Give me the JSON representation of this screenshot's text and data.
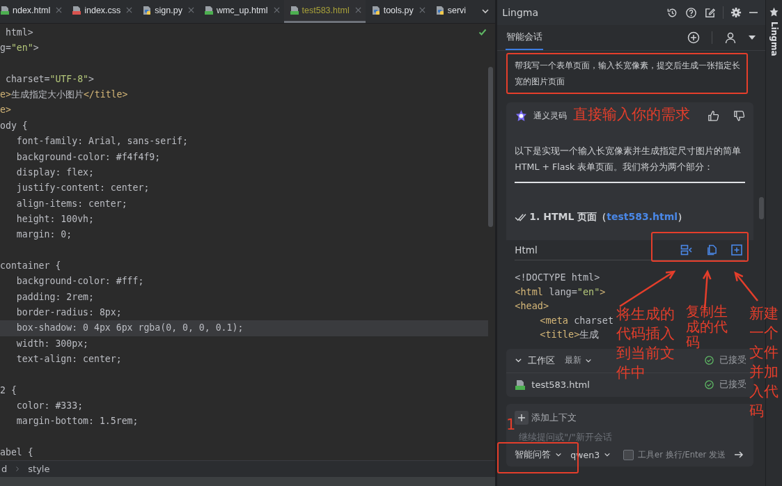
{
  "editor": {
    "tabs": [
      {
        "label": "ndex.html",
        "kind": "html",
        "selected": false,
        "closable": true
      },
      {
        "label": "index.css",
        "kind": "css",
        "selected": false,
        "closable": true
      },
      {
        "label": "sign.py",
        "kind": "py",
        "selected": false,
        "closable": true
      },
      {
        "label": "wmc_up.html",
        "kind": "html",
        "selected": false,
        "closable": true
      },
      {
        "label": "test583.html",
        "kind": "html",
        "selected": true,
        "closable": true
      },
      {
        "label": "tools.py",
        "kind": "py",
        "selected": false,
        "closable": true
      },
      {
        "label": "servi",
        "kind": "py",
        "selected": false,
        "closable": false
      }
    ],
    "lines": [
      {
        "kind": "code",
        "current": false,
        "segments": [
          {
            "text": " html>",
            "kind": "plain"
          }
        ]
      },
      {
        "kind": "code",
        "current": false,
        "segments": [
          {
            "text": "g=",
            "kind": "plain"
          },
          {
            "text": "\"en\"",
            "kind": "str"
          },
          {
            "text": ">",
            "kind": "plain"
          }
        ]
      },
      {
        "kind": "blank",
        "current": false
      },
      {
        "kind": "code",
        "current": false,
        "segments": [
          {
            "text": " charset=",
            "kind": "plain"
          },
          {
            "text": "\"UTF-8\"",
            "kind": "str"
          },
          {
            "text": ">",
            "kind": "plain"
          }
        ]
      },
      {
        "kind": "code",
        "current": false,
        "segments": [
          {
            "text": "e>",
            "kind": "tag"
          },
          {
            "text": "生成指定大小图片",
            "kind": "plain"
          },
          {
            "text": "</title>",
            "kind": "tag"
          }
        ]
      },
      {
        "kind": "code",
        "current": false,
        "segments": [
          {
            "text": "e>",
            "kind": "tag"
          }
        ]
      },
      {
        "kind": "code",
        "current": false,
        "segments": [
          {
            "text": "ody {",
            "kind": "plain"
          }
        ]
      },
      {
        "kind": "code",
        "current": false,
        "segments": [
          {
            "text": "   font-family: Arial, sans-serif;",
            "kind": "plain"
          }
        ]
      },
      {
        "kind": "code",
        "current": false,
        "segments": [
          {
            "text": "   background-color: #f4f4f9;",
            "kind": "plain"
          }
        ]
      },
      {
        "kind": "code",
        "current": false,
        "segments": [
          {
            "text": "   display: flex;",
            "kind": "plain"
          }
        ]
      },
      {
        "kind": "code",
        "current": false,
        "segments": [
          {
            "text": "   justify-content: center;",
            "kind": "plain"
          }
        ]
      },
      {
        "kind": "code",
        "current": false,
        "segments": [
          {
            "text": "   align-items: center;",
            "kind": "plain"
          }
        ]
      },
      {
        "kind": "code",
        "current": false,
        "segments": [
          {
            "text": "   height: 100vh;",
            "kind": "plain"
          }
        ]
      },
      {
        "kind": "code",
        "current": false,
        "segments": [
          {
            "text": "   margin: 0;",
            "kind": "plain"
          }
        ]
      },
      {
        "kind": "blank",
        "current": false
      },
      {
        "kind": "code",
        "current": false,
        "segments": [
          {
            "text": "container {",
            "kind": "plain"
          }
        ]
      },
      {
        "kind": "code",
        "current": false,
        "segments": [
          {
            "text": "   background-color: #fff;",
            "kind": "plain"
          }
        ]
      },
      {
        "kind": "code",
        "current": false,
        "segments": [
          {
            "text": "   padding: 2rem;",
            "kind": "plain"
          }
        ]
      },
      {
        "kind": "code",
        "current": false,
        "segments": [
          {
            "text": "   border-radius: 8px;",
            "kind": "plain"
          }
        ]
      },
      {
        "kind": "code",
        "current": true,
        "segments": [
          {
            "text": "   box-shadow: 0 4px 6px rgba(0, 0, 0, 0.1);",
            "kind": "plain"
          }
        ]
      },
      {
        "kind": "code",
        "current": false,
        "segments": [
          {
            "text": "   width: 300px;",
            "kind": "plain"
          }
        ]
      },
      {
        "kind": "code",
        "current": false,
        "segments": [
          {
            "text": "   text-align: center;",
            "kind": "plain"
          }
        ]
      },
      {
        "kind": "blank",
        "current": false
      },
      {
        "kind": "code",
        "current": false,
        "segments": [
          {
            "text": "2 {",
            "kind": "plain"
          }
        ]
      },
      {
        "kind": "code",
        "current": false,
        "segments": [
          {
            "text": "   color: #333;",
            "kind": "plain"
          }
        ]
      },
      {
        "kind": "code",
        "current": false,
        "segments": [
          {
            "text": "   margin-bottom: 1.5rem;",
            "kind": "plain"
          }
        ]
      },
      {
        "kind": "blank",
        "current": false
      },
      {
        "kind": "code",
        "current": false,
        "segments": [
          {
            "text": "abel {",
            "kind": "plain"
          }
        ]
      }
    ],
    "breadcrumb": [
      "d",
      "style"
    ]
  },
  "panel": {
    "title": "Lingma",
    "tab": {
      "label": "智能会话",
      "selected": true
    },
    "user_message": "帮我写一个表单页面，输入长宽像素，提交后生成一张指定长宽的图片页面",
    "reply": {
      "author": "通义灵码",
      "text": "以下是实现一个输入长宽像素并生成指定尺寸图片的简单 HTML + Flask 表单页面。我们将分为两个部分：",
      "heading": "1. HTML 页面（",
      "heading_link": "test583.html",
      "heading_end": "）",
      "code_block": {
        "language": "Html",
        "lines": [
          {
            "indent": false,
            "segments": [
              {
                "text": "<!DOCTYPE html>",
                "kind": "plain"
              }
            ]
          },
          {
            "indent": false,
            "segments": [
              {
                "text": "<html ",
                "kind": "tag"
              },
              {
                "text": "lang=",
                "kind": "plain"
              },
              {
                "text": "\"en\"",
                "kind": "str"
              },
              {
                "text": ">",
                "kind": "tag"
              }
            ]
          },
          {
            "indent": false,
            "segments": [
              {
                "text": "<head>",
                "kind": "tag"
              }
            ]
          },
          {
            "indent": true,
            "segments": [
              {
                "text": "<meta ",
                "kind": "tag"
              },
              {
                "text": "charset",
                "kind": "plain"
              }
            ]
          },
          {
            "indent": true,
            "segments": [
              {
                "text": "<title>",
                "kind": "tag"
              },
              {
                "text": "生成",
                "kind": "plain"
              }
            ]
          }
        ]
      }
    },
    "workspace": {
      "label": "工作区",
      "filter": "最新",
      "status": "已接受",
      "files": [
        {
          "name": "test583.html",
          "status": "已接受"
        }
      ]
    },
    "input": {
      "context_button": "添加上下文",
      "placeholder": "继续提问或\"/\"新开会话",
      "mode": "智能问答",
      "model": "qwen3",
      "tool_checked": false,
      "tool_label": "工具er 换行/Enter 发送"
    }
  },
  "side_strip": {
    "label": "Lingma"
  },
  "annotations": [
    {
      "kind": "box"
    },
    {
      "kind": "box"
    },
    {
      "kind": "box"
    },
    {
      "kind": "text",
      "text": "直接输入你的需求"
    },
    {
      "kind": "text",
      "text": "将生成的代码插入到当前文件中"
    },
    {
      "kind": "text",
      "text": "复制生成的代码"
    },
    {
      "kind": "text",
      "text": "新建一个文件并加入代码"
    },
    {
      "kind": "text",
      "text": "1"
    },
    {
      "kind": "arrow"
    },
    {
      "kind": "arrow"
    },
    {
      "kind": "arrow"
    }
  ]
}
